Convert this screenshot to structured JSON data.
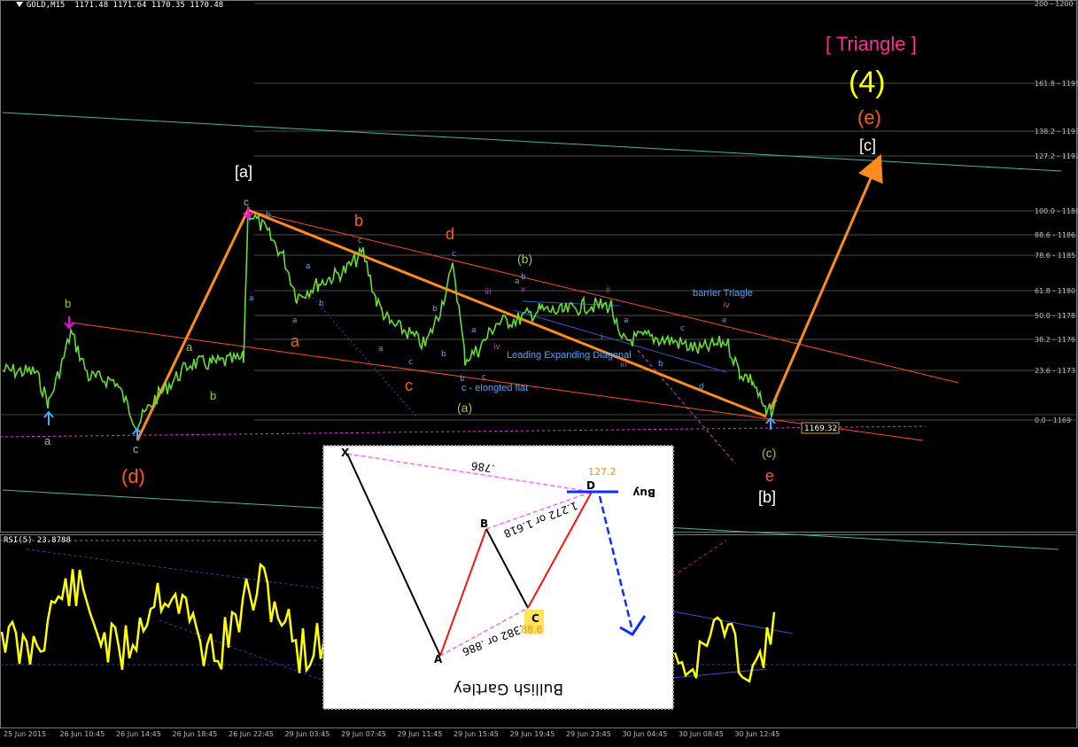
{
  "header": {
    "symbol_tf": "GOLD,M15",
    "ohlc": "1171.48 1171.64 1170.35 1170.48"
  },
  "price_box": "1169.32",
  "rsi_label": "RSI(5) 23.8788",
  "chart_data": {
    "type": "line",
    "instrument": "GOLD",
    "timeframe": "M15",
    "fib_levels": [
      {
        "label": "200 - 1200"
      },
      {
        "label": "161.8 - 1195"
      },
      {
        "label": "138.2 - 1193"
      },
      {
        "label": "127.2 - 1192"
      },
      {
        "label": "100.0 - 1188"
      },
      {
        "label": "88.6 - 1186"
      },
      {
        "label": "78.6 - 1185"
      },
      {
        "label": "61.8 - 1180"
      },
      {
        "label": "50.0 - 1178"
      },
      {
        "label": "38.2 - 1176"
      },
      {
        "label": "23.6 - 1173"
      },
      {
        "label": "0.0 - 1169"
      }
    ],
    "time_labels": [
      "25 Jun 2015",
      "26 Jun 10:45",
      "26 Jun 14:45",
      "26 Jun 18:45",
      "26 Jun 22:45",
      "29 Jun 03:45",
      "29 Jun 07:45",
      "29 Jun 11:45",
      "29 Jun 15:45",
      "29 Jun 19:45",
      "29 Jun 23:45",
      "30 Jun 04:45",
      "30 Jun 08:45",
      "30 Jun 12:45"
    ],
    "wave_labels": [
      {
        "text": "[ Triangle ]",
        "color": "#ff2d9b"
      },
      {
        "text": "(4)",
        "color": "#ffff00"
      },
      {
        "text": "(e)",
        "color": "#ff5a1e"
      },
      {
        "text": "[c]",
        "color": "#ffffff"
      },
      {
        "text": "[a]",
        "color": "#ffffff"
      },
      {
        "text": "c",
        "color": "#9acd32"
      },
      {
        "text": "b",
        "color": "#ff5a1e"
      },
      {
        "text": "d",
        "color": "#ff5a1e"
      },
      {
        "text": "(b)",
        "color": "#9acd32"
      },
      {
        "text": "barrier Triagle",
        "color": "#4aa8ff"
      },
      {
        "text": "b",
        "color": "#9acd32"
      },
      {
        "text": "a",
        "color": "#9acd32"
      },
      {
        "text": "a",
        "color": "#ff5a1e"
      },
      {
        "text": "c",
        "color": "#ff5a1e"
      },
      {
        "text": "b",
        "color": "#9acd32"
      },
      {
        "text": "a",
        "color": "#9acd32"
      },
      {
        "text": "c",
        "color": "#9acd32"
      },
      {
        "text": "(d)",
        "color": "#ff5a1e"
      },
      {
        "text": "Leading Expanding Diagonal",
        "color": "#4aa8ff"
      },
      {
        "text": "c - elongted flat",
        "color": "#4aa8ff"
      },
      {
        "text": "(a)",
        "color": "#9acd32"
      },
      {
        "text": "(c)",
        "color": "#9acd32"
      },
      {
        "text": "e",
        "color": "#ff5a1e"
      },
      {
        "text": "[b]",
        "color": "#ffffff"
      }
    ],
    "minor_labels": [
      {
        "text": "b",
        "color": "#4aa8ff"
      },
      {
        "text": "a",
        "color": "#4aa8ff"
      },
      {
        "text": "c",
        "color": "#4aa8ff"
      },
      {
        "text": "b",
        "color": "#4aa8ff"
      },
      {
        "text": "a",
        "color": "#4aa8ff"
      },
      {
        "text": "c",
        "color": "#4aa8ff"
      },
      {
        "text": "b",
        "color": "#4aa8ff"
      },
      {
        "text": "a",
        "color": "#4aa8ff"
      },
      {
        "text": "c",
        "color": "#4aa8ff"
      },
      {
        "text": "a",
        "color": "#4aa8ff"
      },
      {
        "text": "b",
        "color": "#4aa8ff"
      },
      {
        "text": "a",
        "color": "#4aa8ff"
      },
      {
        "text": "b",
        "color": "#4aa8ff"
      },
      {
        "text": "c",
        "color": "#4aa8ff"
      },
      {
        "text": "v",
        "color": "#d040d0"
      },
      {
        "text": "iii",
        "color": "#d040d0"
      },
      {
        "text": "iv",
        "color": "#d040d0"
      },
      {
        "text": "ii",
        "color": "#d040d0"
      },
      {
        "text": "iii",
        "color": "#d040d0"
      },
      {
        "text": "i",
        "color": "#4aa8ff"
      },
      {
        "text": "a",
        "color": "#4aa8ff"
      },
      {
        "text": "b",
        "color": "#4aa8ff"
      },
      {
        "text": "c",
        "color": "#4aa8ff"
      },
      {
        "text": "d",
        "color": "#4aa8ff"
      },
      {
        "text": "e",
        "color": "#4aa8ff"
      },
      {
        "text": "iv",
        "color": "#d040d0"
      },
      {
        "text": "b",
        "color": "#4aa8ff"
      },
      {
        "text": "a",
        "color": "#4aa8ff"
      }
    ],
    "inset": {
      "title": "Bullish Gartley",
      "points": [
        "X",
        "A",
        "B",
        "C",
        "D"
      ],
      "ratio_xa_d": ".786",
      "ratio_ab_c": ".382 or .886",
      "ratio_bc_d": "1.272 or 1.618",
      "c_value": "88.6",
      "d_value": "127.2",
      "action": "Buy"
    },
    "rsi": {
      "name": "RSI(5)",
      "last": 23.8788
    }
  }
}
